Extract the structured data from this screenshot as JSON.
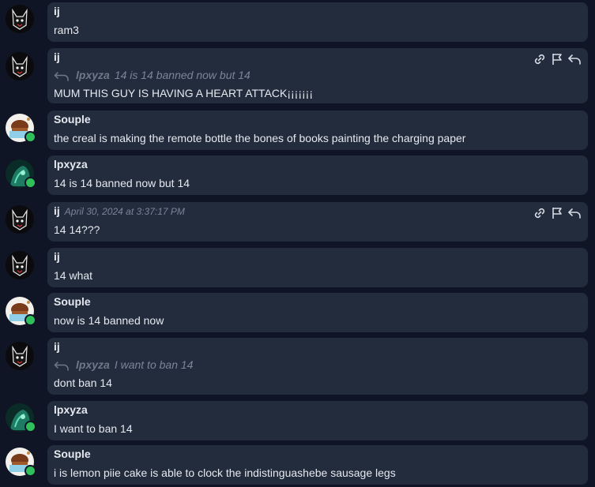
{
  "messages": [
    {
      "author": "ij",
      "avatar": "ij-avatar",
      "online": false,
      "text": "ram3"
    },
    {
      "author": "ij",
      "avatar": "ij-avatar",
      "online": false,
      "reply_author": "lpxyza",
      "reply_text": "14 is 14 banned now but 14",
      "text": "MUM THIS GUY IS HAVING A HEART ATTACK¡¡¡¡¡¡¡",
      "actions": [
        "link-icon",
        "flag-icon",
        "reply-icon"
      ]
    },
    {
      "author": "Souple",
      "avatar": "souple-avatar",
      "online": true,
      "text": "the creal is making the remote bottle the bones of books painting the charging paper"
    },
    {
      "author": "lpxyza",
      "avatar": "lpxyza-avatar",
      "online": true,
      "text": "14 is 14 banned now but 14"
    },
    {
      "author": "ij",
      "avatar": "ij-avatar",
      "online": false,
      "timestamp": "April 30, 2024 at 3:37:17 PM",
      "text": "14 14???",
      "actions": [
        "link-icon",
        "flag-icon",
        "reply-icon"
      ]
    },
    {
      "author": "ij",
      "avatar": "ij-avatar",
      "online": false,
      "text": "14 what"
    },
    {
      "author": "Souple",
      "avatar": "souple-avatar",
      "online": true,
      "text": "now is 14 banned now"
    },
    {
      "author": "ij",
      "avatar": "ij-avatar",
      "online": false,
      "reply_author": "lpxyza",
      "reply_text": "I want to ban 14",
      "text": "dont ban 14"
    },
    {
      "author": "lpxyza",
      "avatar": "lpxyza-avatar",
      "online": true,
      "text": "I want to ban 14"
    },
    {
      "author": "Souple",
      "avatar": "souple-avatar",
      "online": true,
      "text": "i is lemon piie cake is able to clock the indistinguashebe sausage legs"
    }
  ],
  "colors": {
    "background": "#0f1524",
    "bubble": "#222c3d",
    "online": "#2fc05a",
    "muted": "#7b8597"
  }
}
